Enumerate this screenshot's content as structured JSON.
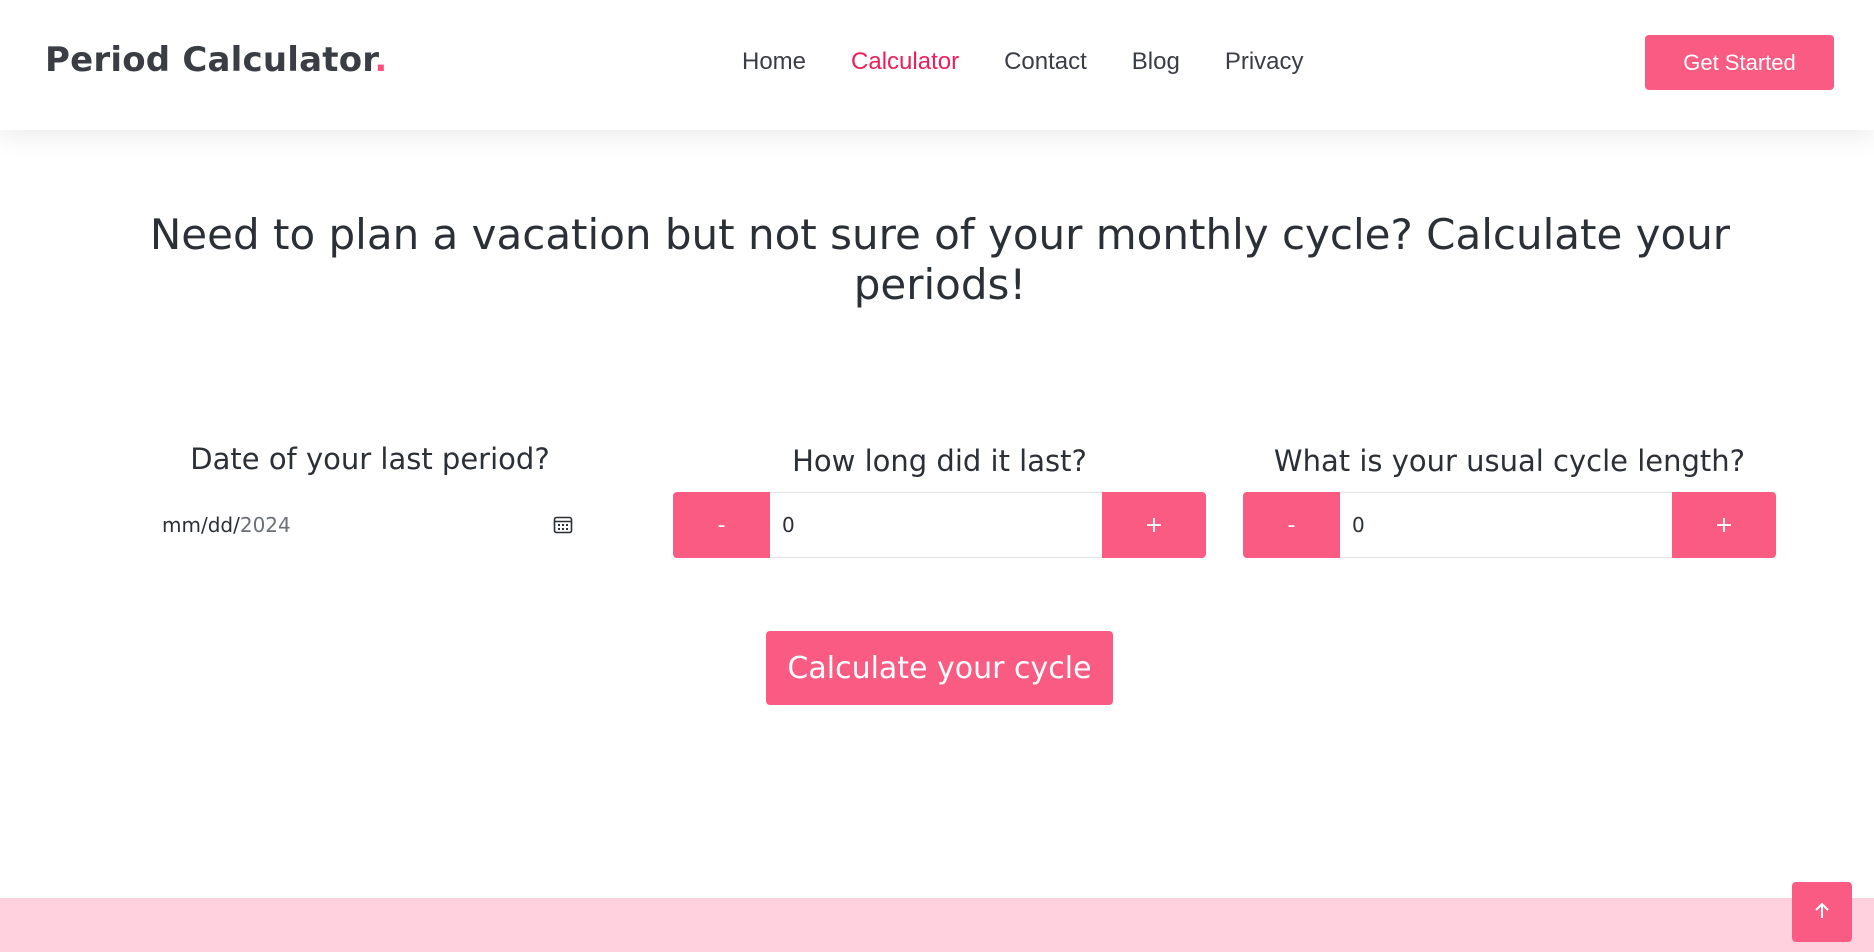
{
  "header": {
    "brand": "Period Calculator",
    "brand_dot": ".",
    "nav": [
      {
        "label": "Home",
        "active": false
      },
      {
        "label": "Calculator",
        "active": true
      },
      {
        "label": "Contact",
        "active": false
      },
      {
        "label": "Blog",
        "active": false
      },
      {
        "label": "Privacy",
        "active": false
      }
    ],
    "cta_label": "Get Started"
  },
  "hero": {
    "title": "Need to plan a vacation but not sure of your monthly cycle? Calculate your periods!"
  },
  "form": {
    "date": {
      "label": "Date of your last period?",
      "format_part": "mm/dd/",
      "year_part": "2024",
      "icon": "calendar-icon"
    },
    "duration": {
      "label": "How long did it last?",
      "minus_label": "-",
      "plus_label": "+",
      "value": "0"
    },
    "cycle": {
      "label": "What is your usual cycle length?",
      "minus_label": "-",
      "plus_label": "+",
      "value": "0"
    },
    "submit_label": "Calculate your cycle"
  },
  "footer": {
    "back_to_top_icon": "arrow-up-icon"
  },
  "colors": {
    "accent": "#f95b83",
    "nav_active": "#ec1f5b",
    "text": "#2b2f36",
    "footer_band": "#ffd0dd"
  }
}
